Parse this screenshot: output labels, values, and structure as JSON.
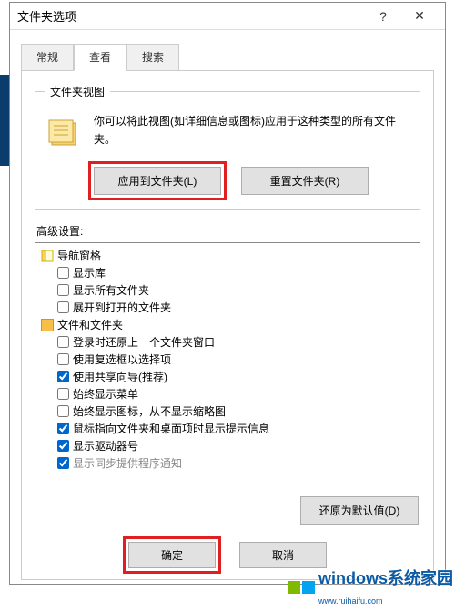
{
  "window": {
    "title": "文件夹选项"
  },
  "tabs": {
    "general": "常规",
    "view": "查看",
    "search": "搜索"
  },
  "folder_view": {
    "legend": "文件夹视图",
    "description": "你可以将此视图(如详细信息或图标)应用于这种类型的所有文件夹。",
    "apply_btn": "应用到文件夹(L)",
    "reset_btn": "重置文件夹(R)"
  },
  "advanced": {
    "label": "高级设置:",
    "nav_group": "导航窗格",
    "files_group": "文件和文件夹",
    "items": [
      {
        "label": "显示库",
        "checked": false
      },
      {
        "label": "显示所有文件夹",
        "checked": false
      },
      {
        "label": "展开到打开的文件夹",
        "checked": false
      },
      {
        "label": "登录时还原上一个文件夹窗口",
        "checked": false
      },
      {
        "label": "使用复选框以选择项",
        "checked": false
      },
      {
        "label": "使用共享向导(推荐)",
        "checked": true
      },
      {
        "label": "始终显示菜单",
        "checked": false
      },
      {
        "label": "始终显示图标，从不显示缩略图",
        "checked": false
      },
      {
        "label": "鼠标指向文件夹和桌面项时显示提示信息",
        "checked": true
      },
      {
        "label": "显示驱动器号",
        "checked": true
      },
      {
        "label": "显示同步提供程序通知",
        "checked": true
      }
    ]
  },
  "buttons": {
    "restore": "还原为默认值(D)",
    "ok": "确定",
    "cancel": "取消"
  },
  "watermark": {
    "text": "windows系统家园",
    "sub": "www.ruihaifu.com"
  }
}
